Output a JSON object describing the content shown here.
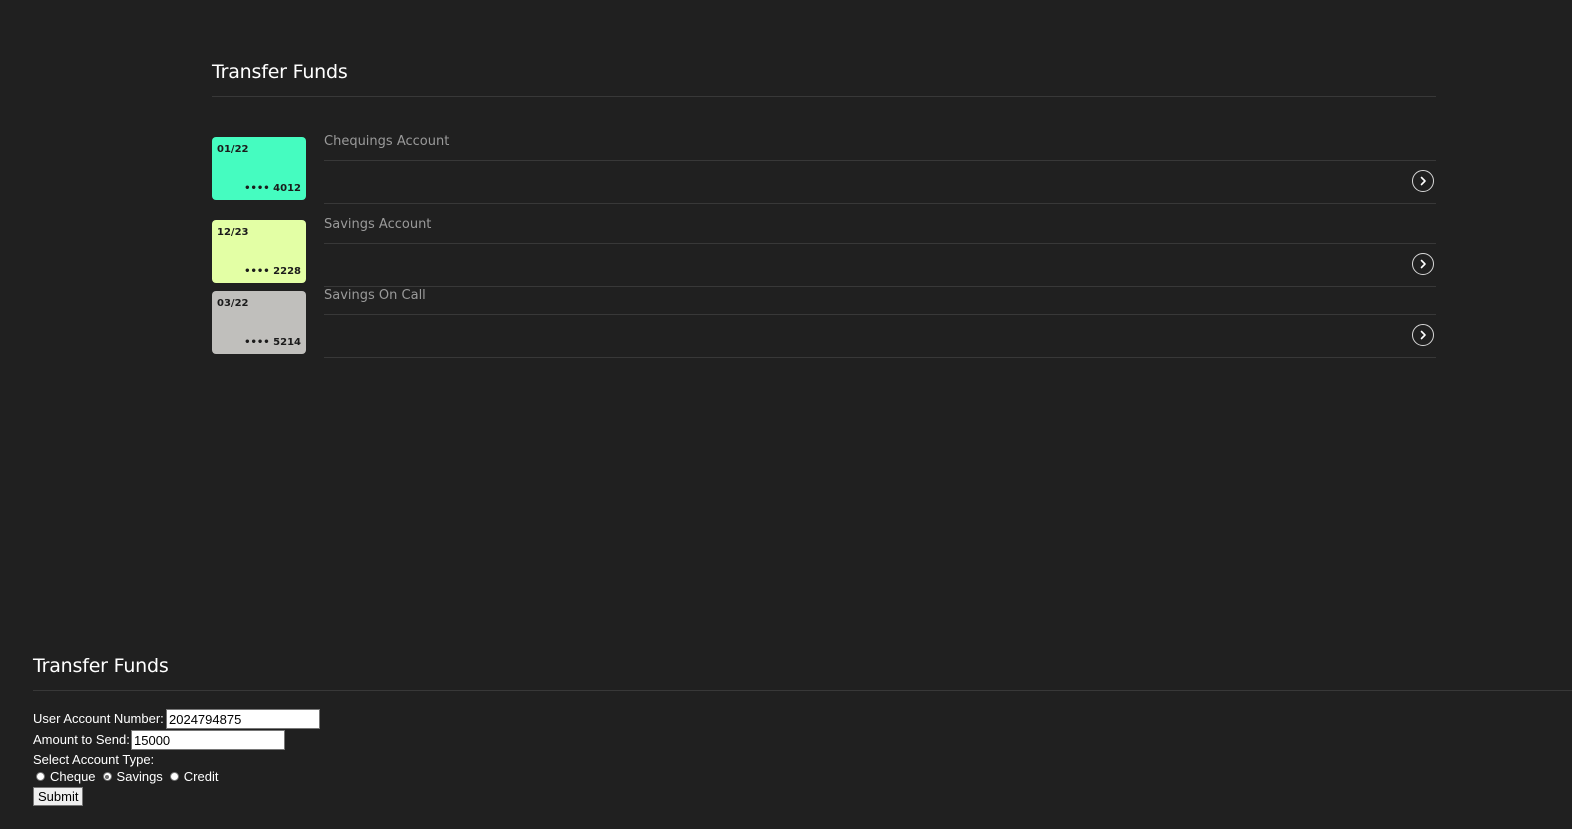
{
  "top": {
    "title": "Transfer Funds",
    "accounts": [
      {
        "name": "Chequings Account",
        "expiry": "01/22",
        "number": "•••• 4012",
        "color": "#45fcc0"
      },
      {
        "name": "Savings Account",
        "expiry": "12/23",
        "number": "•••• 2228",
        "color": "#e3ffa5"
      },
      {
        "name": "Savings On Call",
        "expiry": "03/22",
        "number": "•••• 5214",
        "color": "#c0bfbc"
      }
    ],
    "arrow_icon": "chevron-right-icon"
  },
  "form": {
    "title": "Transfer Funds",
    "account_number_label": "User Account Number:",
    "account_number_value": "2024794875",
    "amount_label": "Amount to Send:",
    "amount_value": "15000",
    "account_type_label": "Select Account Type:",
    "account_types": [
      {
        "label": "Cheque",
        "checked": false
      },
      {
        "label": "Savings",
        "checked": true
      },
      {
        "label": "Credit",
        "checked": false
      }
    ],
    "submit_label": "Submit"
  }
}
